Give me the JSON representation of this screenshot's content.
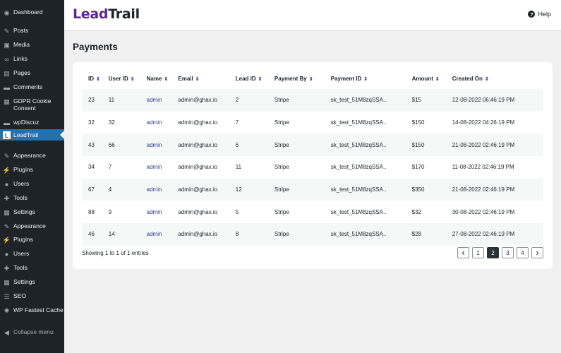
{
  "sidebar": {
    "items": [
      {
        "label": "Dashboard",
        "icon": "dashboard-icon",
        "glyph": "◉"
      },
      {
        "label": "Posts",
        "icon": "pin-icon",
        "glyph": "✎"
      },
      {
        "label": "Media",
        "icon": "media-icon",
        "glyph": "▣"
      },
      {
        "label": "Links",
        "icon": "link-icon",
        "glyph": "∞"
      },
      {
        "label": "Pages",
        "icon": "pages-icon",
        "glyph": "▤"
      },
      {
        "label": "Comments",
        "icon": "comment-icon",
        "glyph": "▬"
      },
      {
        "label": "GDPR Cookie Consent",
        "icon": "shield-icon",
        "glyph": "▦"
      },
      {
        "label": "wpDiscuz",
        "icon": "discuz-icon",
        "glyph": "▬"
      },
      {
        "label": "LeadTrail",
        "icon": "leadtrail-logo-icon",
        "glyph": "L"
      },
      {
        "label": "Appearance",
        "icon": "brush-icon",
        "glyph": "✎"
      },
      {
        "label": "Plugins",
        "icon": "plugin-icon",
        "glyph": "⚡"
      },
      {
        "label": "Users",
        "icon": "user-icon",
        "glyph": "●"
      },
      {
        "label": "Tools",
        "icon": "wrench-icon",
        "glyph": "✚"
      },
      {
        "label": "Settings",
        "icon": "settings-icon",
        "glyph": "▦"
      },
      {
        "label": "Appearance",
        "icon": "brush-icon",
        "glyph": "✎"
      },
      {
        "label": "Plugins",
        "icon": "plugin-icon",
        "glyph": "⚡"
      },
      {
        "label": "Users",
        "icon": "user-icon",
        "glyph": "●"
      },
      {
        "label": "Tools",
        "icon": "wrench-icon",
        "glyph": "✚"
      },
      {
        "label": "Settings",
        "icon": "settings-icon",
        "glyph": "▦"
      },
      {
        "label": "SEO",
        "icon": "seo-icon",
        "glyph": "☰"
      },
      {
        "label": "WP Fastest Cache",
        "icon": "cache-icon",
        "glyph": "✺"
      },
      {
        "label": "Collapse menu",
        "icon": "collapse-icon",
        "glyph": "◀"
      }
    ],
    "active_index": 8
  },
  "header": {
    "brand_part1": "Lead",
    "brand_part2": "Trail",
    "help_label": "Help",
    "help_icon": "help-circle-icon"
  },
  "page": {
    "title": "Payments"
  },
  "table": {
    "columns": [
      "ID",
      "User ID",
      "Name",
      "Email",
      "Lead ID",
      "Payment By",
      "Payment ID",
      "Amount",
      "Created On"
    ],
    "sort_icon": "sort-arrows-icon",
    "rows": [
      [
        "23",
        "11",
        "admin",
        "admin@ghax.io",
        "2",
        "Stripe",
        "sk_test_51M8zqSSA..",
        "$15",
        "12-08-2022 06:46:19 PM"
      ],
      [
        "32",
        "32",
        "admin",
        "admin@ghax.io",
        "7",
        "Stripe",
        "sk_test_51M8zqSSA..",
        "$150",
        "14-08-2022 04:26:19 PM"
      ],
      [
        "43",
        "66",
        "admin",
        "admin@ghax.io",
        "6",
        "Stripe",
        "sk_test_51M8zqSSA..",
        "$150",
        "21-08-2022 02:46:19 PM"
      ],
      [
        "34",
        "7",
        "admin",
        "admin@ghax.io",
        "11",
        "Stripe",
        "sk_test_51M8zqSSA..",
        "$170",
        "11-08-2022 02:46:19 PM"
      ],
      [
        "67",
        "4",
        "admin",
        "admin@ghax.io",
        "12",
        "Stripe",
        "sk_test_51M8zqSSA..",
        "$350",
        "21-08-2022 02:46:19 PM"
      ],
      [
        "88",
        "9",
        "admin",
        "admin@ghax.io",
        "5",
        "Stripe",
        "sk_test_51M8zqSSA..",
        "$32",
        "30-08-2022 02:46:19 PM"
      ],
      [
        "46",
        "14",
        "admin",
        "admin@ghax.io",
        "8",
        "Stripe",
        "sk_test_51M8zqSSA..",
        "$28",
        "27-08-2022 02:46:19 PM"
      ]
    ]
  },
  "footer": {
    "entries_text": "Showing 1 to 1 of 1 entries",
    "pages": [
      "1",
      "2",
      "3",
      "4"
    ],
    "current_page": "2",
    "prev_icon": "chevron-left-icon",
    "next_icon": "chevron-right-icon"
  }
}
